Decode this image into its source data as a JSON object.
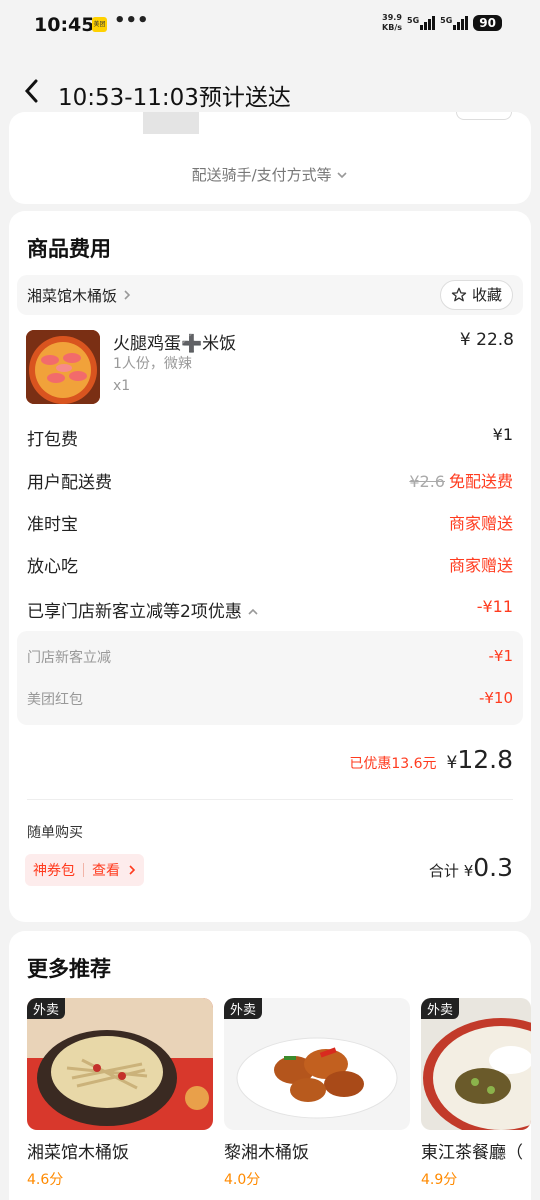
{
  "status_bar": {
    "time": "10:45",
    "app_badge": "美团",
    "more": "•••",
    "net_speed_top": "39.9",
    "net_speed_bottom": "KB/s",
    "sim1": "5G",
    "sim2": "5G",
    "battery": "90"
  },
  "header": {
    "back_icon": "chevron-left-icon",
    "title": "10:53-11:03预计送达"
  },
  "delivery_card": {
    "rider_info": "配送骑手/支付方式等",
    "expand_icon": "chevron-down-icon"
  },
  "goods": {
    "section_title": "商品费用",
    "store": {
      "name": "湘菜馆木桶饭",
      "favorite_label": "收藏",
      "favorite_icon": "star-icon"
    },
    "item": {
      "name": "火腿鸡蛋➕米饭",
      "spec": "1人份，微辣",
      "qty": "x1",
      "price": "¥ 22.8"
    },
    "fees": [
      {
        "label": "打包费",
        "value": "¥1"
      },
      {
        "label": "用户配送费",
        "original": "¥2.6",
        "value": "免配送费"
      },
      {
        "label": "准时宝",
        "value": "商家赠送"
      },
      {
        "label": "放心吃",
        "value": "商家赠送"
      }
    ],
    "discount_summary": {
      "label": "已享门店新客立减等2项优惠",
      "value": "-¥11"
    },
    "discounts": [
      {
        "label": "门店新客立减",
        "value": "-¥1"
      },
      {
        "label": "美团红包",
        "value": "-¥10"
      }
    ],
    "saved": "已优惠13.6元",
    "total_symbol": "¥",
    "total": "12.8"
  },
  "addon": {
    "label": "随单购买",
    "coupon_label": "神券包",
    "coupon_action": "查看",
    "sum_label": "合计",
    "sum_symbol": "¥",
    "sum_value": "0.3"
  },
  "recommend": {
    "title": "更多推荐",
    "items": [
      {
        "tag": "外卖",
        "name": "湘菜馆木桶饭",
        "score": "4.6分"
      },
      {
        "tag": "外卖",
        "name": "黎湘木桶饭",
        "score": "4.0分"
      },
      {
        "tag": "外卖",
        "name": "東江茶餐廳（",
        "score": "4.9分"
      }
    ]
  },
  "colors": {
    "accent_red": "#ff3b1f",
    "score_orange": "#ff8a00"
  }
}
